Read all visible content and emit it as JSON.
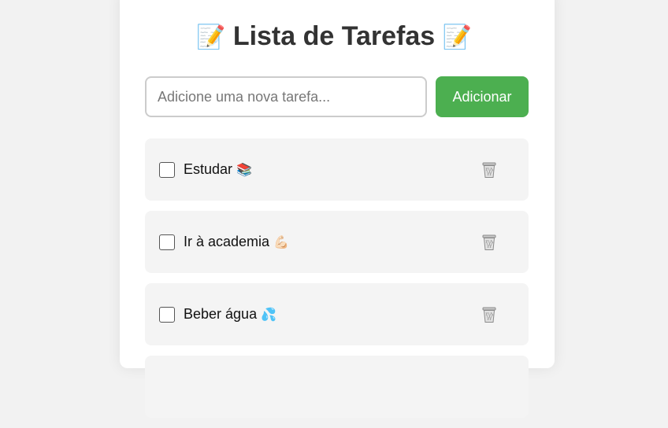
{
  "header": {
    "title": "Lista de Tarefas",
    "title_icon_left": "📝",
    "title_icon_right": "📝"
  },
  "add_task": {
    "placeholder": "Adicione uma nova tarefa...",
    "value": "",
    "button_label": "Adicionar"
  },
  "tasks": [
    {
      "label": "Estudar",
      "emoji": "📚",
      "checked": false,
      "delete_icon": "trash-icon"
    },
    {
      "label": "Ir à academia",
      "emoji": "💪🏻",
      "checked": false,
      "delete_icon": "trash-icon"
    },
    {
      "label": "Beber água",
      "emoji": "💦",
      "checked": false,
      "delete_icon": "trash-icon"
    }
  ],
  "colors": {
    "accent": "#4caf50",
    "background": "#f2f2f2",
    "card": "#ffffff",
    "task_background": "#f4f4f4"
  }
}
